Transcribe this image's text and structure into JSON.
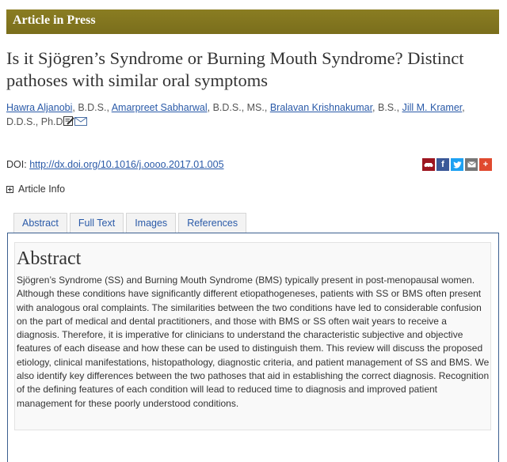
{
  "banner": {
    "label": "Article in Press"
  },
  "article": {
    "title": "Is it Sjögren’s Syndrome or Burning Mouth Syndrome? Distinct pathoses with similar oral symptoms",
    "authors": [
      {
        "name": "Hawra Aljanobi",
        "degree": ", B.D.S., "
      },
      {
        "name": "Amarpreet Sabharwal",
        "degree": ", B.D.S., MS., "
      },
      {
        "name": "Bralavan Krishnakumar",
        "degree": ", B.S., "
      },
      {
        "name": "Jill M. Kramer",
        "degree": ", D.D.S., Ph.D"
      }
    ],
    "doi_label": "DOI:",
    "doi_link": "http://dx.doi.org/10.1016/j.oooo.2017.01.005",
    "article_info_label": "Article Info"
  },
  "share": {
    "icons": [
      "mendeley-icon",
      "facebook-icon",
      "twitter-icon",
      "email-icon",
      "more-icon"
    ]
  },
  "tabs": [
    "Abstract",
    "Full Text",
    "Images",
    "References"
  ],
  "abstract": {
    "heading": "Abstract",
    "text": "Sjögren’s Syndrome (SS) and Burning Mouth Syndrome (BMS) typically present in post-menopausal women. Although these conditions have significantly different etiopathogeneses, patients with SS or BMS often present with analogous oral complaints. The similarities between the two conditions have led to considerable confusion on the part of medical and dental practitioners, and those with BMS or SS often wait years to receive a diagnosis. Therefore, it is imperative for clinicians to understand the characteristic subjective and objective features of each disease and how these can be used to distinguish them. This review will discuss the proposed etiology, clinical manifestations, histopathology, diagnostic criteria, and patient management of SS and BMS. We also identify key differences between the two pathoses that aid in establishing the correct diagnosis. Recognition of the defining features of each condition will lead to reduced time to diagnosis and improved patient management for these poorly understood conditions."
  },
  "colors": {
    "banner": "#7f7320",
    "link": "#2a5aa8",
    "panel_border": "#3b5f8f"
  }
}
